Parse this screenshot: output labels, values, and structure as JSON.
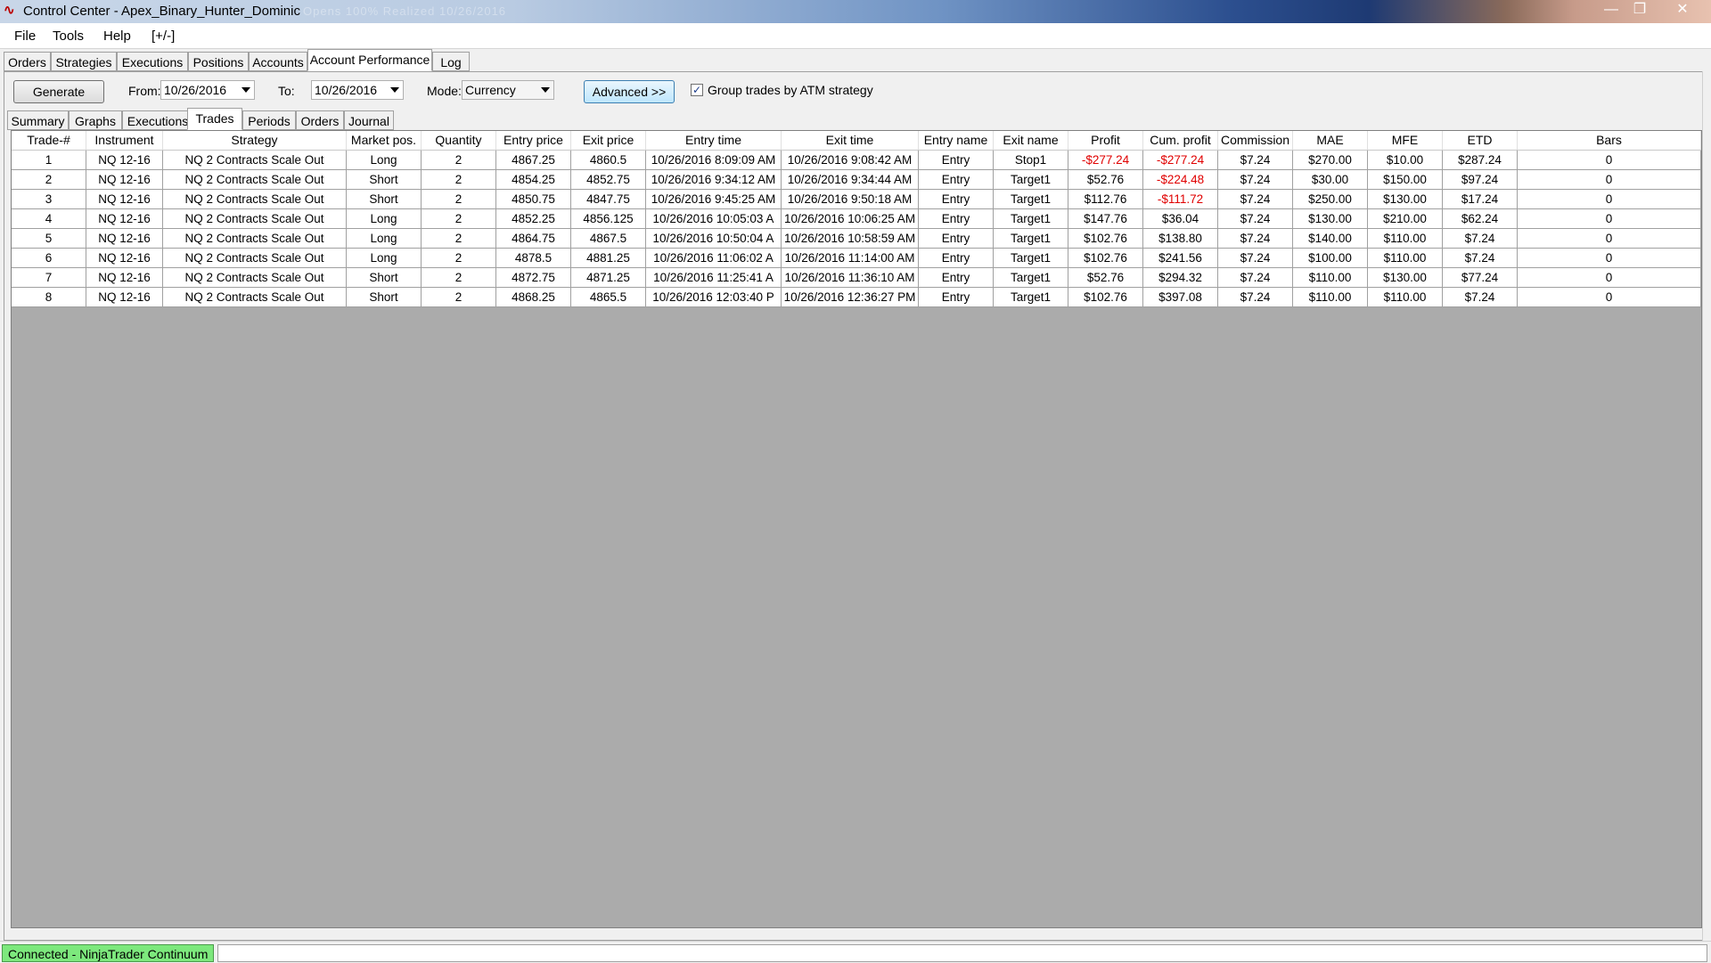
{
  "window": {
    "title": "Control Center - Apex_Binary_Hunter_Dominic",
    "faded_title": "Opens 100% Realized 10/26/2016"
  },
  "menu": {
    "items": [
      "File",
      "Tools",
      "Help",
      "[+/-]"
    ]
  },
  "main_tabs": [
    "Orders",
    "Strategies",
    "Executions",
    "Positions",
    "Accounts",
    "Account Performance",
    "Log"
  ],
  "controls": {
    "generate_label": "Generate",
    "from_label": "From:",
    "from_value": "10/26/2016",
    "to_label": "To:",
    "to_value": "10/26/2016",
    "mode_label": "Mode:",
    "mode_value": "Currency",
    "advanced_label": "Advanced >>",
    "group_trades_label": "Group trades by ATM strategy",
    "group_trades_checked": true
  },
  "sub_tabs": [
    "Summary",
    "Graphs",
    "Executions",
    "Trades",
    "Periods",
    "Orders",
    "Journal"
  ],
  "columns": [
    "Trade-#",
    "Instrument",
    "Strategy",
    "Market pos.",
    "Quantity",
    "Entry price",
    "Exit price",
    "Entry time",
    "Exit time",
    "Entry name",
    "Exit name",
    "Profit",
    "Cum. profit",
    "Commission",
    "MAE",
    "MFE",
    "ETD",
    "Bars"
  ],
  "rows": [
    [
      "1",
      "NQ 12-16",
      "NQ 2 Contracts Scale Out",
      "Long",
      "2",
      "4867.25",
      "4860.5",
      "10/26/2016 8:09:09 AM",
      "10/26/2016 9:08:42 AM",
      "Entry",
      "Stop1",
      "-$277.24",
      "-$277.24",
      "$7.24",
      "$270.00",
      "$10.00",
      "$287.24",
      "0"
    ],
    [
      "2",
      "NQ 12-16",
      "NQ 2 Contracts Scale Out",
      "Short",
      "2",
      "4854.25",
      "4852.75",
      "10/26/2016 9:34:12 AM",
      "10/26/2016 9:34:44 AM",
      "Entry",
      "Target1",
      "$52.76",
      "-$224.48",
      "$7.24",
      "$30.00",
      "$150.00",
      "$97.24",
      "0"
    ],
    [
      "3",
      "NQ 12-16",
      "NQ 2 Contracts Scale Out",
      "Short",
      "2",
      "4850.75",
      "4847.75",
      "10/26/2016 9:45:25 AM",
      "10/26/2016 9:50:18 AM",
      "Entry",
      "Target1",
      "$112.76",
      "-$111.72",
      "$7.24",
      "$250.00",
      "$130.00",
      "$17.24",
      "0"
    ],
    [
      "4",
      "NQ 12-16",
      "NQ 2 Contracts Scale Out",
      "Long",
      "2",
      "4852.25",
      "4856.125",
      "10/26/2016 10:05:03 A",
      "10/26/2016 10:06:25 AM",
      "Entry",
      "Target1",
      "$147.76",
      "$36.04",
      "$7.24",
      "$130.00",
      "$210.00",
      "$62.24",
      "0"
    ],
    [
      "5",
      "NQ 12-16",
      "NQ 2 Contracts Scale Out",
      "Long",
      "2",
      "4864.75",
      "4867.5",
      "10/26/2016 10:50:04 A",
      "10/26/2016 10:58:59 AM",
      "Entry",
      "Target1",
      "$102.76",
      "$138.80",
      "$7.24",
      "$140.00",
      "$110.00",
      "$7.24",
      "0"
    ],
    [
      "6",
      "NQ 12-16",
      "NQ 2 Contracts Scale Out",
      "Long",
      "2",
      "4878.5",
      "4881.25",
      "10/26/2016 11:06:02 A",
      "10/26/2016 11:14:00 AM",
      "Entry",
      "Target1",
      "$102.76",
      "$241.56",
      "$7.24",
      "$100.00",
      "$110.00",
      "$7.24",
      "0"
    ],
    [
      "7",
      "NQ 12-16",
      "NQ 2 Contracts Scale Out",
      "Short",
      "2",
      "4872.75",
      "4871.25",
      "10/26/2016 11:25:41 A",
      "10/26/2016 11:36:10 AM",
      "Entry",
      "Target1",
      "$52.76",
      "$294.32",
      "$7.24",
      "$110.00",
      "$130.00",
      "$77.24",
      "0"
    ],
    [
      "8",
      "NQ 12-16",
      "NQ 2 Contracts Scale Out",
      "Short",
      "2",
      "4868.25",
      "4865.5",
      "10/26/2016 12:03:40 P",
      "10/26/2016 12:36:27 PM",
      "Entry",
      "Target1",
      "$102.76",
      "$397.08",
      "$7.24",
      "$110.00",
      "$110.00",
      "$7.24",
      "0"
    ]
  ],
  "status": {
    "connection": "Connected - NinjaTrader Continuum"
  },
  "colors": {
    "negative": "#e00000",
    "status_ok": "#7de87d"
  }
}
